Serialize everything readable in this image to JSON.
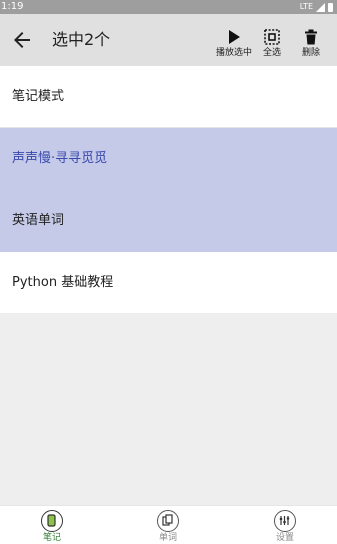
{
  "status_bar": {
    "time": "1:19",
    "network": "LTE"
  },
  "toolbar": {
    "title": "选中2个",
    "actions": [
      {
        "label": "播放选中",
        "icon": "play-icon"
      },
      {
        "label": "全选",
        "icon": "select-all-icon"
      },
      {
        "label": "删除",
        "icon": "trash-icon"
      }
    ]
  },
  "notebooks": [
    {
      "title": "笔记模式",
      "selected": false
    },
    {
      "title": "声声慢·寻寻觅觅",
      "selected": true
    },
    {
      "title": "英语单词",
      "selected": true
    },
    {
      "title": "Python 基础教程",
      "selected": false
    }
  ],
  "bottom_nav": [
    {
      "label": "笔记",
      "icon": "notebook-icon",
      "active": true
    },
    {
      "label": "单词",
      "icon": "words-icon",
      "active": false
    },
    {
      "label": "设置",
      "icon": "settings-icon",
      "active": false
    }
  ],
  "colors": {
    "selected_row": "#c5cae9",
    "accent_text": "#3949ab",
    "active_nav": "#2e7d32",
    "active_nav_fill": "#8bc34a"
  }
}
